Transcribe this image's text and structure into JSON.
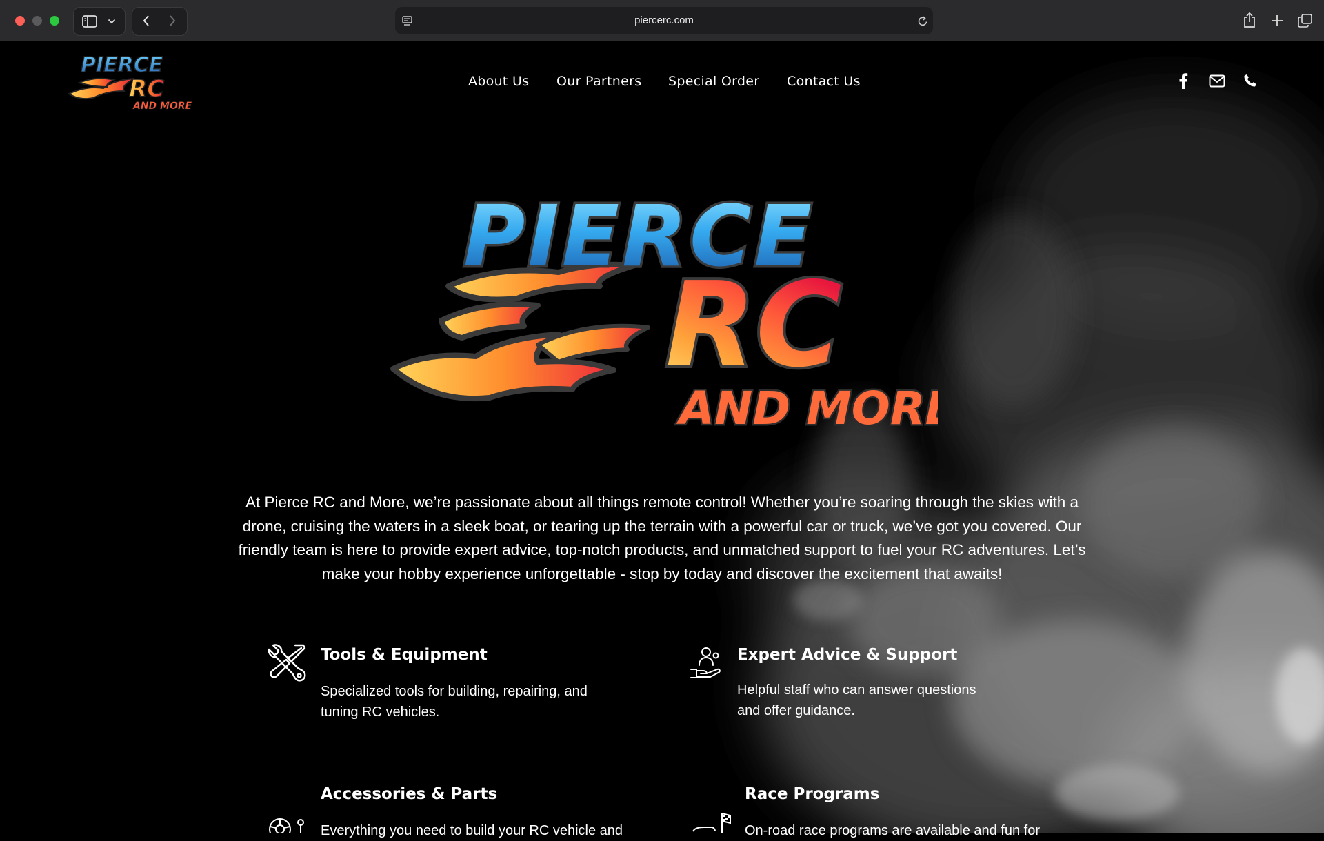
{
  "browser": {
    "url": "piercerc.com"
  },
  "site": {
    "logo": {
      "line1": "PIERCE",
      "line2": "RC",
      "line3": "AND MORE"
    },
    "nav": [
      "About Us",
      "Our Partners",
      "Special Order",
      "Contact Us"
    ],
    "social_icons": [
      "facebook-icon",
      "mail-icon",
      "phone-icon"
    ]
  },
  "intro": "At Pierce RC and More, we’re passionate about all things remote control! Whether you’re soaring through the skies with a drone, cruising the waters in a sleek boat, or tearing up the terrain with a powerful car or truck, we’ve got you covered. Our friendly team is here to provide expert advice, top-notch products, and unmatched support to fuel your RC adventures. Let’s make your hobby experience unforgettable - stop by today and discover the excitement that awaits!",
  "features": [
    {
      "title": "Tools & Equipment",
      "desc": "Specialized tools for building, repairing, and tuning RC vehicles.",
      "icon": "tools-icon"
    },
    {
      "title": "Expert Advice & Support",
      "desc": "Helpful staff who can answer questions and offer guidance.",
      "icon": "support-icon"
    },
    {
      "title": "Accessories & Parts",
      "desc": "Everything you need to build your RC vehicle and",
      "icon": "parts-icon"
    },
    {
      "title": "Race Programs",
      "desc": "On-road race programs are available and fun for",
      "icon": "race-flag-icon"
    }
  ]
}
